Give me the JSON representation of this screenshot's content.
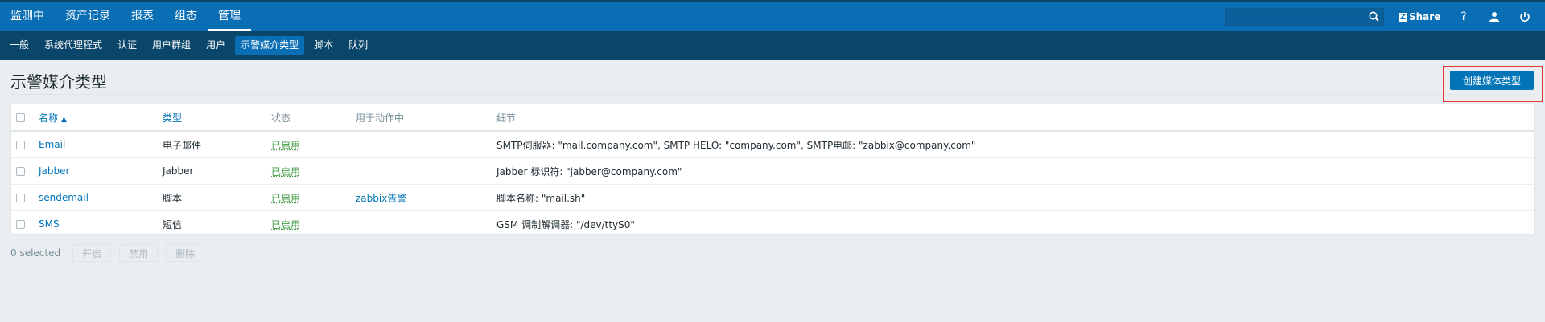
{
  "nav": {
    "main": [
      "监测中",
      "资产记录",
      "报表",
      "组态",
      "管理"
    ],
    "active_main": "管理",
    "share_label": "Share",
    "share_logo": "Z",
    "help_label": "?",
    "sub": [
      "一般",
      "系统代理程式",
      "认证",
      "用户群组",
      "用户",
      "示警媒介类型",
      "脚本",
      "队列"
    ],
    "active_sub": "示警媒介类型"
  },
  "search": {
    "value": "",
    "placeholder": ""
  },
  "page": {
    "title": "示警媒介类型",
    "create_button": "创建媒体类型",
    "highlight_color": "#e33734"
  },
  "table": {
    "headers": [
      "名称",
      "类型",
      "状态",
      "用于动作中",
      "细节"
    ],
    "sort_indicator": "▲",
    "rows": [
      {
        "name": "Email",
        "type": "电子邮件",
        "status": "已启用",
        "action": "",
        "details": "SMTP伺服器: \"mail.company.com\", SMTP HELO: \"company.com\", SMTP电邮: \"zabbix@company.com\""
      },
      {
        "name": "Jabber",
        "type": "Jabber",
        "status": "已启用",
        "action": "",
        "details": "Jabber 标识符: \"jabber@company.com\""
      },
      {
        "name": "sendemail",
        "type": "脚本",
        "status": "已启用",
        "action": "zabbix告警",
        "details": "脚本名称: \"mail.sh\""
      },
      {
        "name": "SMS",
        "type": "短信",
        "status": "已启用",
        "action": "",
        "details": "GSM 调制解调器: \"/dev/ttyS0\""
      }
    ]
  },
  "footer": {
    "selected_text": "0 selected",
    "buttons": [
      "开启",
      "禁用",
      "删除"
    ]
  },
  "colors": {
    "topbar": "#0a6eb4",
    "subbar": "#0a466a",
    "accent": "#0275b8",
    "enabled": "#429e47"
  }
}
